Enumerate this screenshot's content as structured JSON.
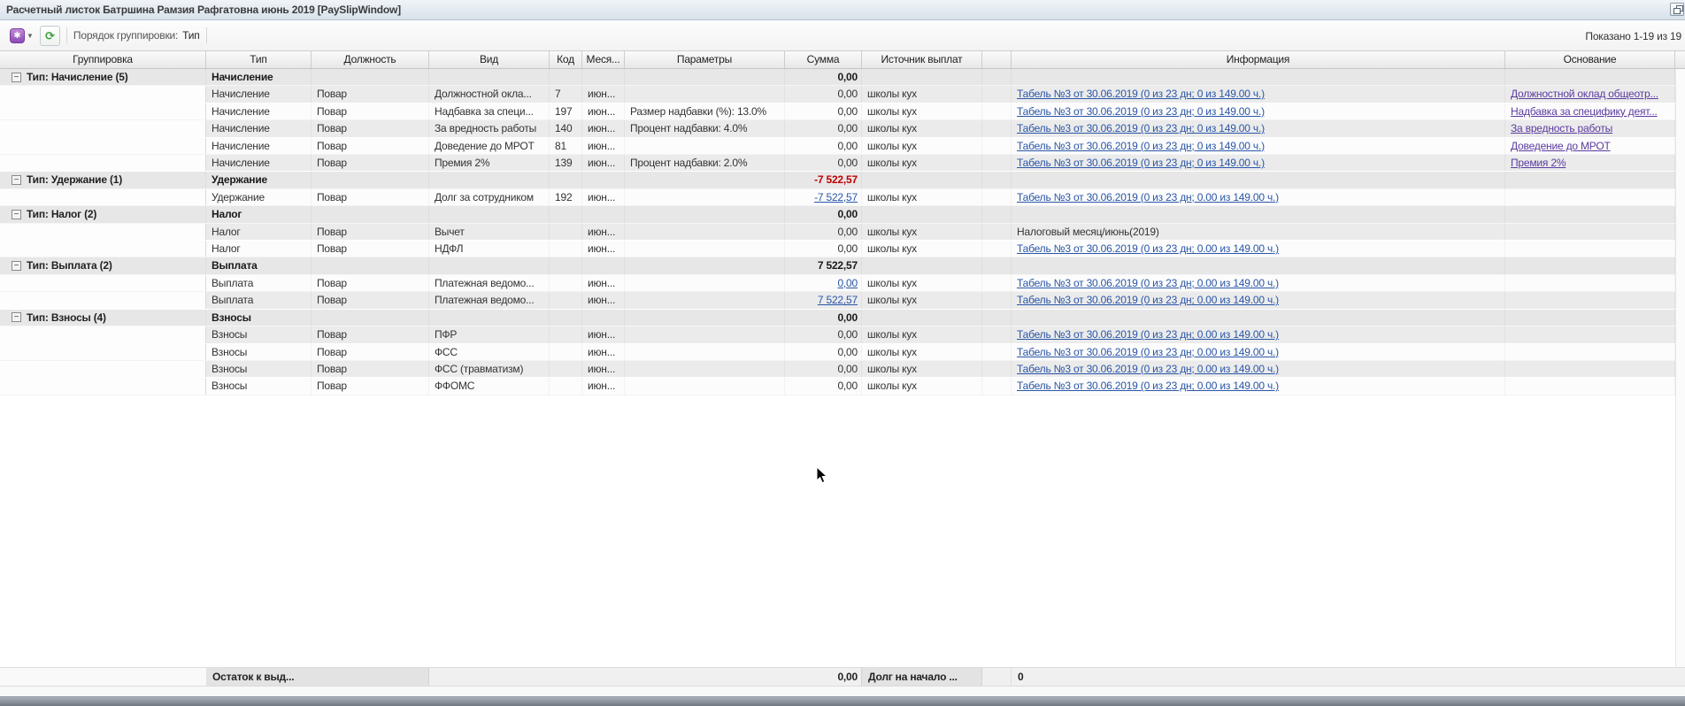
{
  "window": {
    "title": "Расчетный листок Батршина Рамзия Рафгатовна июнь 2019 [PaySlipWindow]"
  },
  "toolbar": {
    "grouping_label": "Порядок группировки:",
    "grouping_value": "Тип",
    "records_shown": "Показано 1-19 из 19"
  },
  "icons": {
    "actions": "purple-actions-icon",
    "dropdown": "chevron-down-icon",
    "refresh": "refresh-icon",
    "collapse": "collapse-minus-icon",
    "window_restore": "restore-window-icon",
    "pointer": "mouse-cursor-arrow"
  },
  "colors": {
    "accent_link": "#2a56a8",
    "basis_link": "#5b3aa0",
    "negative": "#c00000"
  },
  "table": {
    "columns": [
      "Группировка",
      "Тип",
      "Должность",
      "Вид",
      "Код",
      "Меся...",
      "Параметры",
      "Сумма",
      "Источник выплат",
      "",
      "Информация",
      "Основание"
    ],
    "rows": [
      {
        "kind": "group",
        "label": "Тип: Начисление (5)",
        "type": "Начисление",
        "sum": "0,00",
        "sum_red": false
      },
      {
        "kind": "data",
        "shaded": true,
        "type": "Начисление",
        "position": "Повар",
        "vid": "Должностной окла...",
        "code": "7",
        "month": "июн...",
        "params": "",
        "sum": "0,00",
        "sum_link": false,
        "source": "школы кух",
        "info": "Табель №3 от 30.06.2019 (0 из 23 дн; 0 из 149.00 ч.)",
        "info_link": true,
        "basis": "Должностной оклад общеотр..."
      },
      {
        "kind": "data",
        "shaded": false,
        "type": "Начисление",
        "position": "Повар",
        "vid": "Надбавка за специ...",
        "code": "197",
        "month": "июн...",
        "params": "Размер надбавки (%): 13.0%",
        "sum": "0,00",
        "sum_link": false,
        "source": "школы кух",
        "info": "Табель №3 от 30.06.2019 (0 из 23 дн; 0 из 149.00 ч.)",
        "info_link": true,
        "basis": "Надбавка за специфику деят..."
      },
      {
        "kind": "data",
        "shaded": true,
        "type": "Начисление",
        "position": "Повар",
        "vid": "За вредность работы",
        "code": "140",
        "month": "июн...",
        "params": "Процент надбавки: 4.0%",
        "sum": "0,00",
        "sum_link": false,
        "source": "школы кух",
        "info": "Табель №3 от 30.06.2019 (0 из 23 дн; 0 из 149.00 ч.)",
        "info_link": true,
        "basis": "За вредность работы"
      },
      {
        "kind": "data",
        "shaded": false,
        "type": "Начисление",
        "position": "Повар",
        "vid": "Доведение до МРОТ",
        "code": "81",
        "month": "июн...",
        "params": "",
        "sum": "0,00",
        "sum_link": false,
        "source": "школы кух",
        "info": "Табель №3 от 30.06.2019 (0 из 23 дн; 0 из 149.00 ч.)",
        "info_link": true,
        "basis": "Доведение до МРОТ"
      },
      {
        "kind": "data",
        "shaded": true,
        "type": "Начисление",
        "position": "Повар",
        "vid": "Премия 2%",
        "code": "139",
        "month": "июн...",
        "params": "Процент надбавки: 2.0%",
        "sum": "0,00",
        "sum_link": false,
        "source": "школы кух",
        "info": "Табель №3 от 30.06.2019 (0 из 23 дн; 0 из 149.00 ч.)",
        "info_link": true,
        "basis": "Премия 2%"
      },
      {
        "kind": "group",
        "label": "Тип: Удержание (1)",
        "type": "Удержание",
        "sum": "-7 522,57",
        "sum_red": true
      },
      {
        "kind": "data",
        "shaded": false,
        "type": "Удержание",
        "position": "Повар",
        "vid": "Долг за сотрудником",
        "code": "192",
        "month": "июн...",
        "params": "",
        "sum": "-7 522,57",
        "sum_link": true,
        "source": "школы кух",
        "info": "Табель №3 от 30.06.2019 (0 из 23 дн; 0.00 из 149.00 ч.)",
        "info_link": true,
        "basis": ""
      },
      {
        "kind": "group",
        "label": "Тип: Налог (2)",
        "type": "Налог",
        "sum": "0,00",
        "sum_red": false
      },
      {
        "kind": "data",
        "shaded": true,
        "type": "Налог",
        "position": "Повар",
        "vid": "Вычет",
        "code": "",
        "month": "июн...",
        "params": "",
        "sum": "0,00",
        "sum_link": false,
        "source": "школы кух",
        "info": "Налоговый месяц/июнь(2019)",
        "info_link": false,
        "basis": ""
      },
      {
        "kind": "data",
        "shaded": false,
        "type": "Налог",
        "position": "Повар",
        "vid": "НДФЛ",
        "code": "",
        "month": "июн...",
        "params": "",
        "sum": "0,00",
        "sum_link": false,
        "source": "школы кух",
        "info": "Табель №3 от 30.06.2019 (0 из 23 дн; 0.00 из 149.00 ч.)",
        "info_link": true,
        "basis": ""
      },
      {
        "kind": "group",
        "label": "Тип: Выплата (2)",
        "type": "Выплата",
        "sum": "7 522,57",
        "sum_red": false
      },
      {
        "kind": "data",
        "shaded": false,
        "type": "Выплата",
        "position": "Повар",
        "vid": "Платежная ведомо...",
        "code": "",
        "month": "июн...",
        "params": "",
        "sum": "0,00",
        "sum_link": true,
        "source": "школы кух",
        "info": "Табель №3 от 30.06.2019 (0 из 23 дн; 0.00 из 149.00 ч.)",
        "info_link": true,
        "basis": ""
      },
      {
        "kind": "data",
        "shaded": true,
        "type": "Выплата",
        "position": "Повар",
        "vid": "Платежная ведомо...",
        "code": "",
        "month": "июн...",
        "params": "",
        "sum": "7 522,57",
        "sum_link": true,
        "source": "школы кух",
        "info": "Табель №3 от 30.06.2019 (0 из 23 дн; 0.00 из 149.00 ч.)",
        "info_link": true,
        "basis": ""
      },
      {
        "kind": "group",
        "label": "Тип: Взносы (4)",
        "type": "Взносы",
        "sum": "0,00",
        "sum_red": false
      },
      {
        "kind": "data",
        "shaded": true,
        "type": "Взносы",
        "position": "Повар",
        "vid": "ПФР",
        "code": "",
        "month": "июн...",
        "params": "",
        "sum": "0,00",
        "sum_link": false,
        "source": "школы кух",
        "info": "Табель №3 от 30.06.2019 (0 из 23 дн; 0.00 из 149.00 ч.)",
        "info_link": true,
        "basis": ""
      },
      {
        "kind": "data",
        "shaded": false,
        "type": "Взносы",
        "position": "Повар",
        "vid": "ФСС",
        "code": "",
        "month": "июн...",
        "params": "",
        "sum": "0,00",
        "sum_link": false,
        "source": "школы кух",
        "info": "Табель №3 от 30.06.2019 (0 из 23 дн; 0.00 из 149.00 ч.)",
        "info_link": true,
        "basis": ""
      },
      {
        "kind": "data",
        "shaded": true,
        "type": "Взносы",
        "position": "Повар",
        "vid": "ФСС (травматизм)",
        "code": "",
        "month": "июн...",
        "params": "",
        "sum": "0,00",
        "sum_link": false,
        "source": "школы кух",
        "info": "Табель №3 от 30.06.2019 (0 из 23 дн; 0.00 из 149.00 ч.)",
        "info_link": true,
        "basis": ""
      },
      {
        "kind": "data",
        "shaded": false,
        "type": "Взносы",
        "position": "Повар",
        "vid": "ФФОМС",
        "code": "",
        "month": "июн...",
        "params": "",
        "sum": "0,00",
        "sum_link": false,
        "source": "школы кух",
        "info": "Табель №3 от 30.06.2019 (0 из 23 дн; 0.00 из 149.00 ч.)",
        "info_link": true,
        "basis": ""
      }
    ]
  },
  "footer": {
    "balance_label": "Остаток к выд...",
    "balance_value": "0,00",
    "debt_label": "Долг на начало ...",
    "debt_value": "0"
  }
}
